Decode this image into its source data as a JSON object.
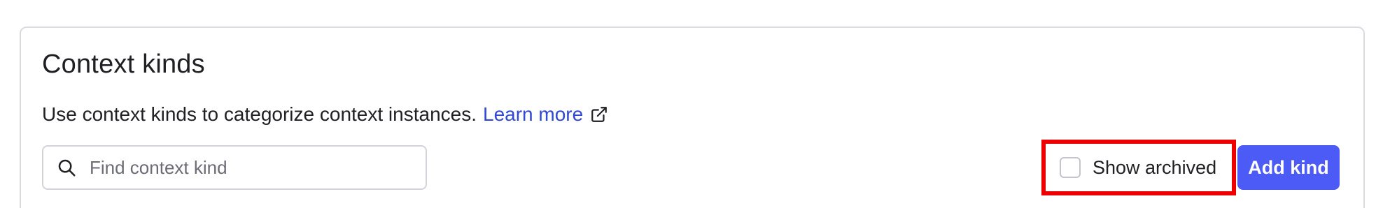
{
  "card": {
    "title": "Context kinds",
    "description": "Use context kinds to categorize context instances.",
    "learn_more_label": "Learn more"
  },
  "search": {
    "placeholder": "Find context kind",
    "value": ""
  },
  "show_archived": {
    "label": "Show archived",
    "checked": false
  },
  "add_button": {
    "label": "Add kind"
  },
  "colors": {
    "link": "#3048d4",
    "primary_button": "#4c5bf5",
    "highlight": "#ee0000",
    "border": "#dadbe0"
  },
  "icons": {
    "search": "search-icon",
    "external_link": "external-link-icon"
  }
}
